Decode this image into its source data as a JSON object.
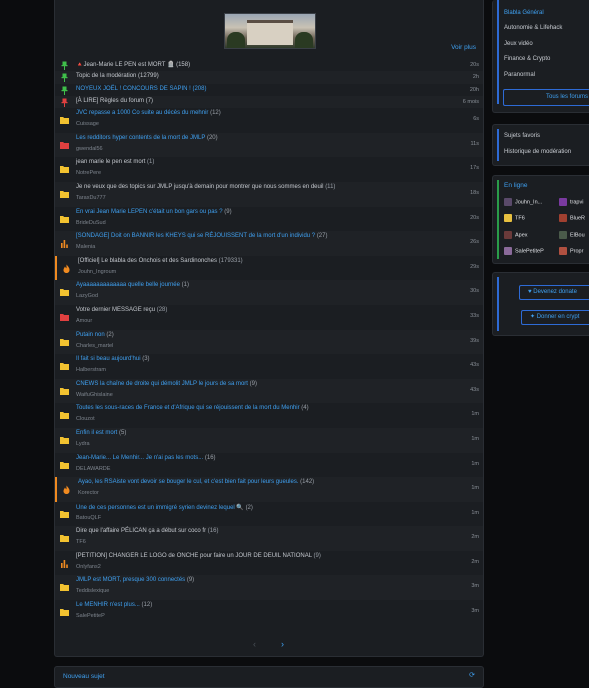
{
  "banner": {
    "voir_plus": "Voir plus"
  },
  "topics": [
    {
      "icon": "pin-green-icon",
      "title": "🔺Jean-Marie LE PEN est MORT 🪦 (158)",
      "author": "",
      "time": "20s",
      "blue": false
    },
    {
      "icon": "pin-green-icon",
      "title": "Topic de la modération (12799)",
      "author": "",
      "time": "2h",
      "blue": false
    },
    {
      "icon": "pin-green-icon",
      "title": "NOYEUX JOËL ! CONCOURS DE SAPIN ! (208)",
      "author": "",
      "time": "20h",
      "blue": true
    },
    {
      "icon": "pin-red-icon",
      "title": "[À LIRE] Règles du forum (7)",
      "author": "",
      "time": "6 mois",
      "blue": false
    },
    {
      "icon": "folder-yellow-icon",
      "title": "JVC repasse a 1000 Co suite au décès du mehnir",
      "count": "(12)",
      "author": "Cuissage",
      "time": "6s",
      "blue": true
    },
    {
      "icon": "folder-red-icon",
      "title": "Les redditors hyper contents de la mort de JMLP",
      "count": "(20)",
      "author": "gwendal56",
      "time": "11s",
      "blue": true
    },
    {
      "icon": "folder-yellow-icon",
      "title": "jean marie le pen est mort",
      "count": "(1)",
      "author": "NotrePere",
      "time": "17s",
      "blue": false
    },
    {
      "icon": "folder-yellow-icon",
      "title": "Je ne veux que des topics sur JMLP jusqu'à demain pour montrer que nous sommes en deuil",
      "count": "(11)",
      "author": "TaraxDu777",
      "time": "18s",
      "blue": false
    },
    {
      "icon": "folder-yellow-icon",
      "title": "En vrai Jean Marie LEPEN c'était un bon gars ou pas ?",
      "count": "(9)",
      "author": "BrideDuSud",
      "time": "20s",
      "blue": true
    },
    {
      "icon": "poll-icon",
      "title": "[SONDAGE] Doit on BANNIR les KHEYS qui se RÉJOUISSENT de la mort d'un individu ?",
      "count": "(27)",
      "author": "Malenia",
      "time": "26s",
      "blue": true
    },
    {
      "icon": "fire-icon",
      "title": "[Officiel] Le blabla des Onchois et des Sardinonches",
      "count": "(179331)",
      "author": "Jouhn_Ingroum",
      "time": "29s",
      "blue": false,
      "hot": true
    },
    {
      "icon": "folder-yellow-icon",
      "title": "Ayaaaaaaaaaaaaa quelle belle journée",
      "count": "(1)",
      "author": "LazyGod",
      "time": "30s",
      "blue": true
    },
    {
      "icon": "folder-red-icon",
      "title": "Votre dernier MESSAGE reçu",
      "count": "(28)",
      "author": "Amour",
      "time": "33s",
      "blue": false
    },
    {
      "icon": "folder-yellow-icon",
      "title": "Putain non",
      "count": "(2)",
      "author": "Charles_martel",
      "time": "39s",
      "blue": true
    },
    {
      "icon": "folder-yellow-icon",
      "title": "Il fait si beau aujourd'hui",
      "count": "(3)",
      "author": "Halberstram",
      "time": "43s",
      "blue": true
    },
    {
      "icon": "folder-yellow-icon",
      "title": "CNEWS la chaîne de droite qui démolit JMLP le jours de sa mort",
      "count": "(9)",
      "author": "WaifuGhislaine",
      "time": "43s",
      "blue": true
    },
    {
      "icon": "folder-yellow-icon",
      "title": "Toutes les sous-races de France et d'Afrique qui se réjouissent de la mort du Menhir",
      "count": "(4)",
      "author": "Clouzot",
      "time": "1m",
      "blue": true
    },
    {
      "icon": "folder-yellow-icon",
      "title": "Enfin il est mort",
      "count": "(5)",
      "author": "Lydra",
      "time": "1m",
      "blue": true
    },
    {
      "icon": "folder-yellow-icon",
      "title": "Jean-Marie... Le Menhir... Je n'ai pas les mots...",
      "count": "(16)",
      "author": "DELAWARDE",
      "time": "1m",
      "blue": true
    },
    {
      "icon": "fire-icon",
      "title": "Ayao, les RSAiste vont devoir se bouger le cul, et c'est bien fait pour leurs gueules.",
      "count": "(142)",
      "author": "Korector",
      "time": "1m",
      "blue": true,
      "hot": true
    },
    {
      "icon": "folder-yellow-icon",
      "title": "Une de ces personnes est un immigré syrien devinez lequel 🔍",
      "count": "(2)",
      "author": "BatouQLF",
      "time": "1m",
      "blue": true
    },
    {
      "icon": "folder-yellow-icon",
      "title": "Dire que l'affaire PÉLICAN ça a début sur coco fr",
      "count": "(16)",
      "author": "TF6",
      "time": "2m",
      "blue": false
    },
    {
      "icon": "poll-icon",
      "title": "[PETITION] CHANGER LE LOGO de ONCHE pour faire un JOUR DE DEUIL NATIONAL",
      "count": "(9)",
      "author": "Onlyfans2",
      "time": "2m",
      "blue": false
    },
    {
      "icon": "folder-yellow-icon",
      "title": "JMLP est MORT, presque 300 connectés",
      "count": "(9)",
      "author": "Teddislexique",
      "time": "3m",
      "blue": true
    },
    {
      "icon": "folder-yellow-icon",
      "title": "Le MENHIR n'est plus...",
      "count": "(12)",
      "author": "SalePetiteP",
      "time": "3m",
      "blue": true
    }
  ],
  "pager": {
    "prev": "‹",
    "next": "›"
  },
  "nouveau": {
    "label": "Nouveau sujet",
    "refresh": "⟳"
  },
  "sidebar": {
    "forums": [
      "Blabla Général",
      "Autonomie & Lifehack",
      "Jeux vidéo",
      "Finance & Crypto",
      "Paranormal"
    ],
    "all_forums": "Tous les forums",
    "links": [
      "Sujets favoris",
      "Historique de modération"
    ],
    "online_title": "En ligne",
    "users": [
      "Jouhn_In...",
      "trapvi",
      "TF6",
      "BlueR",
      "Apex",
      "ElBou",
      "SalePetiteP",
      "Propr"
    ],
    "donate": "Devenez donate",
    "crypto": "Donner en crypt"
  },
  "colors": {
    "accent": "#3fa0f0",
    "bg": "#1b1e22",
    "page": "#0b0c0e",
    "border": "#2a2e34",
    "folder": "#f2c230",
    "red": "#e04040",
    "green": "#3fbf4a",
    "hot": "#f08a20"
  }
}
